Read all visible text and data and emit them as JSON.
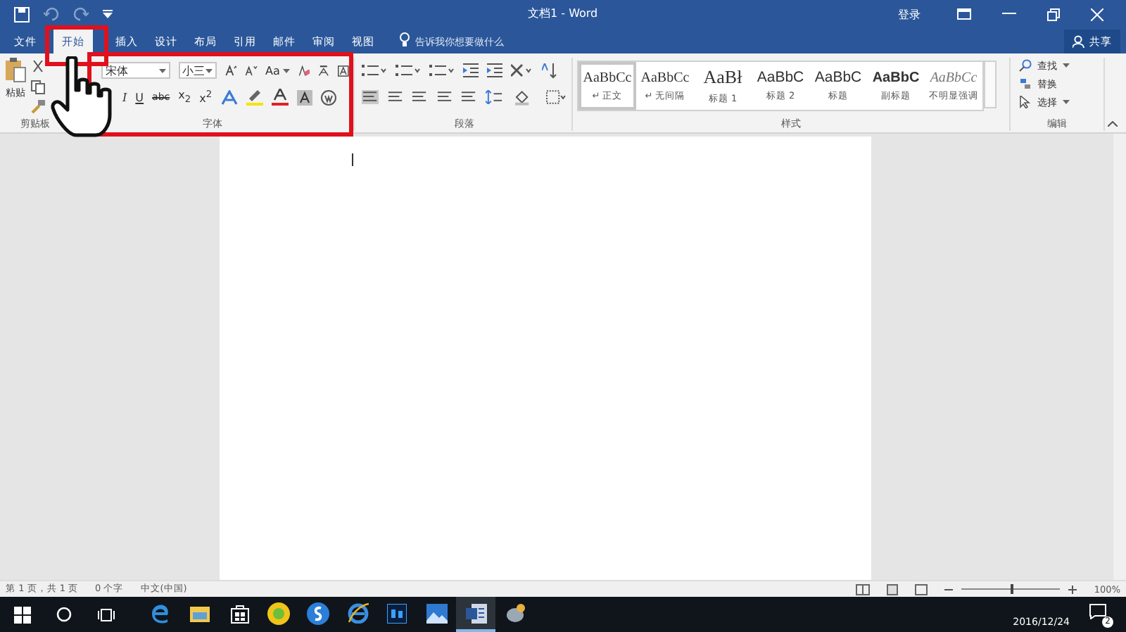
{
  "window": {
    "title": "文档1 - Word",
    "sign_in": "登录"
  },
  "tabs": [
    {
      "label": "文件",
      "selected": false
    },
    {
      "label": "开始",
      "selected": true
    },
    {
      "label": "插入",
      "selected": false
    },
    {
      "label": "设计",
      "selected": false
    },
    {
      "label": "布局",
      "selected": false
    },
    {
      "label": "引用",
      "selected": false
    },
    {
      "label": "邮件",
      "selected": false
    },
    {
      "label": "审阅",
      "selected": false
    },
    {
      "label": "视图",
      "selected": false
    }
  ],
  "tell_me": {
    "placeholder": "告诉我你想要做什么"
  },
  "share": "共享",
  "clipboard": {
    "paste": "粘贴",
    "label": "剪贴板"
  },
  "font": {
    "name": "宋体",
    "size": "小三",
    "case": "Aa",
    "format_buttons": [
      "I",
      "U",
      "abc",
      "x$_{2}$",
      "x$^{2}$"
    ],
    "label": "字体"
  },
  "paragraph": {
    "label": "段落"
  },
  "styles": {
    "label": "样式",
    "items": [
      {
        "preview": "AaBbCc",
        "name": "↵ 正文",
        "kind": "normal",
        "selected": true
      },
      {
        "preview": "AaBbCc",
        "name": "↵ 无间隔",
        "kind": "normal",
        "selected": false
      },
      {
        "preview": "AaBł",
        "name": "标题 1",
        "kind": "title",
        "selected": false
      },
      {
        "preview": "AaBbC",
        "name": "标题 2",
        "kind": "heading",
        "selected": false
      },
      {
        "preview": "AaBbC",
        "name": "标题",
        "kind": "heading",
        "selected": false
      },
      {
        "preview": "AaBbC",
        "name": "副标题",
        "kind": "strong",
        "selected": false
      },
      {
        "preview": "AaBbCc",
        "name": "不明显强调",
        "kind": "emphasis",
        "selected": false
      }
    ]
  },
  "editing": {
    "label": "编辑",
    "items": [
      {
        "label": "查找",
        "dropdown": true
      },
      {
        "label": "替换",
        "dropdown": false
      },
      {
        "label": "选择",
        "dropdown": true
      }
    ]
  },
  "status_bar": {
    "page": "第 1 页，共 1 页",
    "words": "0 个字",
    "language": "中文(中国)",
    "zoom": "100%",
    "zoom_slider": {
      "level": 0.5
    }
  },
  "taskbar": {
    "date": "2016/12/24",
    "notifications": "2"
  }
}
